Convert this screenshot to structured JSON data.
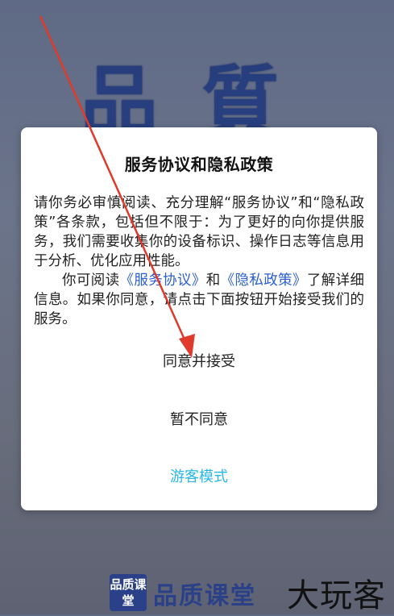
{
  "background": {
    "logo_glyphs": [
      "品",
      "質"
    ]
  },
  "dialog": {
    "title": "服务协议和隐私政策",
    "para1": "请你务必审慎阅读、充分理解“服务协议”和“隐私政策”各条款，包括但不限于：为了更好的向你提供服务，我们需要收集你的设备标识、操作日志等信息用于分析、优化应用性能。",
    "para2_prefix": "你可阅读",
    "service_link": "《服务协议》",
    "para2_and": "和",
    "privacy_link": "《隐私政策》",
    "para2_suffix": "了解详细信息。如果你同意，请点击下面按钮开始接受我们的服务。",
    "accept_label": "同意并接受",
    "decline_label": "暂不同意",
    "guest_label": "游客模式"
  },
  "footer": {
    "logo_box_text": "品质课堂",
    "app_title": "品质课堂"
  },
  "watermark": "大玩客",
  "colors": {
    "link": "#2a5fd3",
    "guest": "#29b7e8",
    "arrow": "#e03a2a",
    "brand": "#2a4088"
  }
}
